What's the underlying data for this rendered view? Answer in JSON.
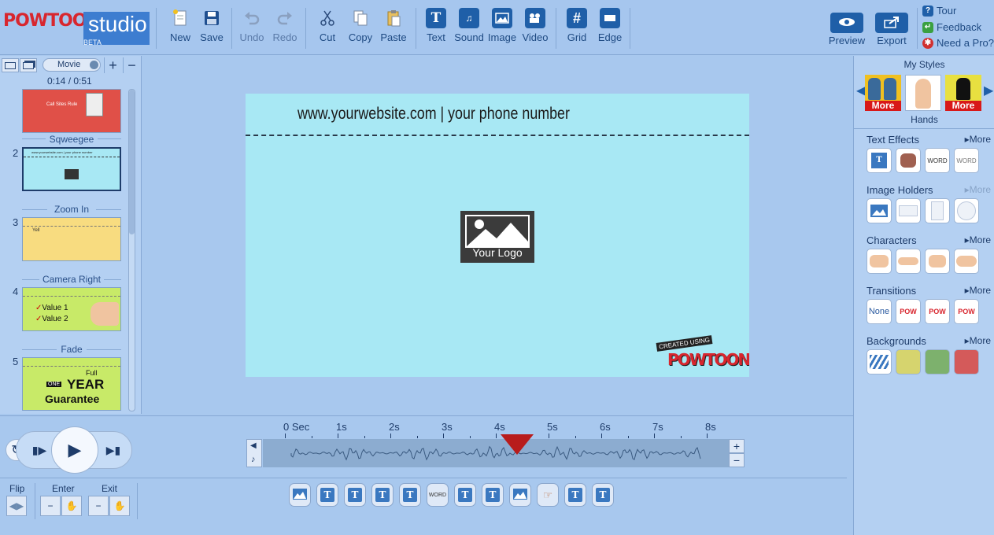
{
  "brand": {
    "logo": "POWTOON",
    "studio": "studio",
    "beta": "BETA"
  },
  "toolbar": {
    "new": "New",
    "save": "Save",
    "undo": "Undo",
    "redo": "Redo",
    "cut": "Cut",
    "copy": "Copy",
    "paste": "Paste",
    "text": "Text",
    "sound": "Sound",
    "image": "Image",
    "video": "Video",
    "grid": "Grid",
    "edge": "Edge",
    "preview": "Preview",
    "export": "Export"
  },
  "help": {
    "tour": "Tour",
    "feedback": "Feedback",
    "pro": "Need a Pro?"
  },
  "leftpanel": {
    "mode": "Movie",
    "time": "0:14 / 0:51",
    "slides": [
      {
        "num": "",
        "transition": "Sqweegee",
        "text": "Call Sites Rule"
      },
      {
        "num": "2",
        "transition": "Zoom In",
        "text": "www.yourwebsite.com | your phone number"
      },
      {
        "num": "3",
        "transition": "Camera Right",
        "text": "Yell"
      },
      {
        "num": "4",
        "transition": "Fade",
        "text1": "Value 1",
        "text2": "Value 2"
      },
      {
        "num": "5",
        "transition": "",
        "text1": "Full",
        "text2": "ONE",
        "text3": "YEAR",
        "text4": "Guarantee"
      }
    ]
  },
  "stage": {
    "url_text": "www.yourwebsite.com |  your phone number",
    "logo_text": "Your Logo",
    "watermark_top": "CREATED USING",
    "watermark_bottom": "POWTOON"
  },
  "rightpanel": {
    "my_styles": "My Styles",
    "styles_selected": "Hands",
    "more": "More",
    "text_effects": "Text Effects",
    "image_holders": "Image Holders",
    "characters": "Characters",
    "transitions": "Transitions",
    "transition_none": "None",
    "transition_pow": "POW",
    "backgrounds": "Backgrounds",
    "word_label": "WORD",
    "colors": {
      "bg_yellow": "#d6d46e",
      "bg_green": "#7db16d",
      "bg_red": "#d45a5a"
    }
  },
  "timeline": {
    "ticks": [
      "0 Sec",
      "1s",
      "2s",
      "3s",
      "4s",
      "5s",
      "6s",
      "7s",
      "8s"
    ],
    "playhead_seconds": 4.4
  },
  "bottom": {
    "flip": "Flip",
    "enter": "Enter",
    "exit": "Exit"
  },
  "colors": {
    "accent": "#1f5fa8",
    "stage_bg": "#a8e8f4",
    "playhead": "#b81c1c"
  }
}
